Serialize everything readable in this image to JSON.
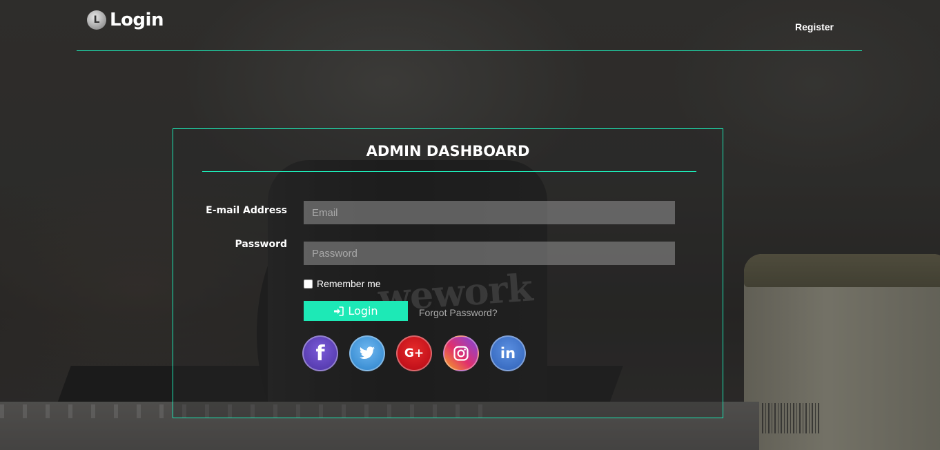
{
  "header": {
    "brand_initial": "L",
    "brand_text": "Login",
    "register_label": "Register"
  },
  "background": {
    "mug_text": "wework"
  },
  "card": {
    "title": "ADMIN DASHBOARD",
    "email_label": "E-mail Address",
    "email_placeholder": "Email",
    "email_value": "",
    "password_label": "Password",
    "password_placeholder": "Password",
    "password_value": "",
    "remember_label": "Remember me",
    "remember_checked": false,
    "login_button_label": "Login",
    "forgot_label": "Forgot Password?"
  },
  "socials": [
    {
      "name": "facebook-icon",
      "glyph": "f"
    },
    {
      "name": "twitter-icon",
      "glyph": ""
    },
    {
      "name": "google-plus-icon",
      "glyph": "G+"
    },
    {
      "name": "instagram-icon",
      "glyph": ""
    },
    {
      "name": "linkedin-icon",
      "glyph": "in"
    }
  ],
  "colors": {
    "accent": "#1de9b6",
    "text": "#ffffff",
    "muted": "#a9a9a9"
  }
}
